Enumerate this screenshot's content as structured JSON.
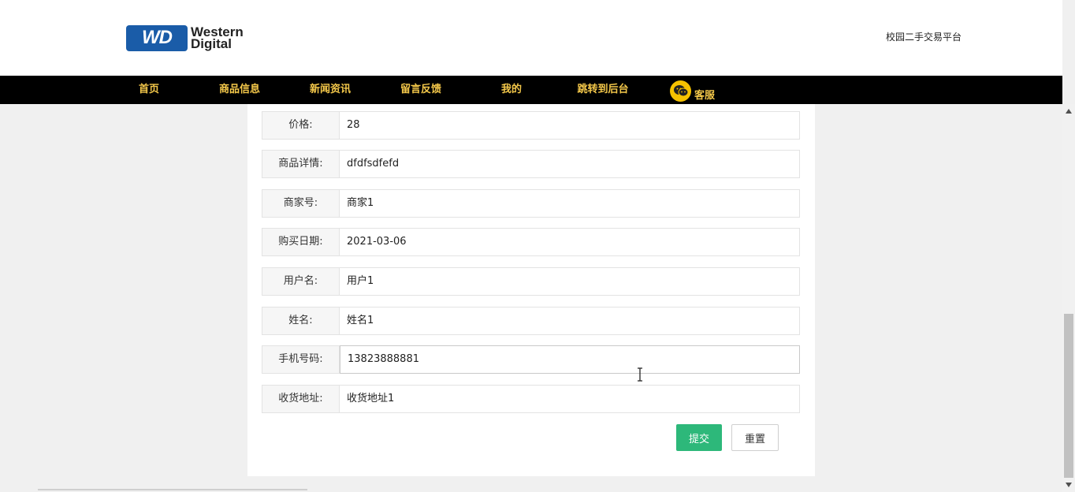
{
  "header": {
    "logo_line1": "Western",
    "logo_line2": "Digital",
    "logo_mark": "WD",
    "site_title": "校园二手交易平台"
  },
  "nav": {
    "items": [
      {
        "label": "首页"
      },
      {
        "label": "商品信息"
      },
      {
        "label": "新闻资讯"
      },
      {
        "label": "留言反馈"
      },
      {
        "label": "我的"
      },
      {
        "label": "跳转到后台"
      }
    ],
    "service_label": "客服",
    "service_icon": "wechat-icon"
  },
  "form": {
    "fields": [
      {
        "label": "价格:",
        "value": "28"
      },
      {
        "label": "商品详情:",
        "value": "dfdfsdfefd"
      },
      {
        "label": "商家号:",
        "value": "商家1"
      },
      {
        "label": "购买日期:",
        "value": "2021-03-06"
      },
      {
        "label": "用户名:",
        "value": "用户1"
      },
      {
        "label": "姓名:",
        "value": "姓名1"
      },
      {
        "label": "手机号码:",
        "value": "13823888881"
      },
      {
        "label": "收货地址:",
        "value": "收货地址1"
      }
    ],
    "submit_label": "提交",
    "reset_label": "重置"
  },
  "colors": {
    "nav_bg": "#000000",
    "nav_text": "#f4c84a",
    "submit_bg": "#2db87a",
    "logo_blue": "#1a5ca8"
  }
}
